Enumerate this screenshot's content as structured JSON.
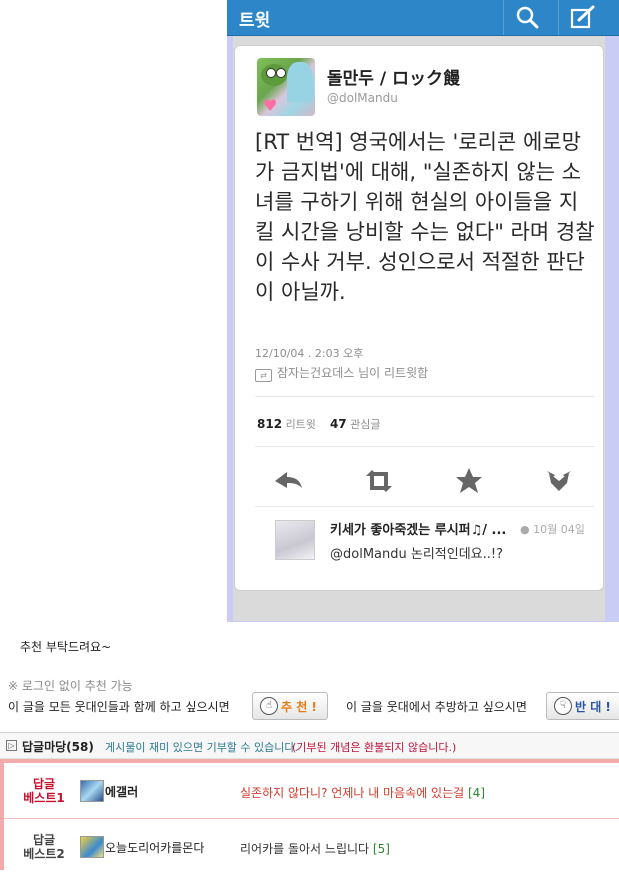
{
  "tweet_app": {
    "header_title": "트윗",
    "author_name": "돌만두 / ロック饅",
    "author_handle": "@dolMandu",
    "tweet_text": "[RT 번역] 영국에서는 '로리콘 에로망가 금지법'에 대해, \"실존하지 않는 소녀를 구하기 위해 현실의 아이들을 지킬 시간을 낭비할 수는 없다\" 라며 경찰이 수사 거부. 성인으로서 적절한 판단이 아닐까.",
    "timestamp": "12/10/04 . 2:03 오후",
    "retweeted_by": "잠자는건요데스 님이 리트윗함",
    "retweet_count": "812",
    "retweet_label": "리트윗",
    "favorite_count": "47",
    "favorite_label": "관심글",
    "reply_name": "키세가 좋아죽겠는 루시퍼♫/ ...",
    "reply_time": "10월 04일",
    "reply_text": "@dolMandu 논리적인데요..!?"
  },
  "post": {
    "request_text": "추천 부탁드려요~",
    "login_note": "※ 로그인 없이 추천 가능",
    "recommend_prompt": "이 글을 모든 웃대인들과 함께 하고 싶으시면",
    "recommend_label": "추 천 !",
    "oppose_prompt": "이 글을 웃대에서 추방하고 싶으시면",
    "oppose_label": "반 대 !"
  },
  "comments": {
    "title": "답글마당",
    "count": "(58)",
    "note1": "게시물이 재미 있으면 기부할 수 있습니다.",
    "note2": "(기부된 개념은 환불되지 않습니다.)",
    "best": [
      {
        "rank_line1": "답글",
        "rank_line2": "베스트1",
        "user": "에갤러",
        "text": "실존하지 않다니? 언제나 내 마음속에 있는걸",
        "count": "[4]"
      },
      {
        "rank_line1": "답글",
        "rank_line2": "베스트2",
        "user": "오늘도리어카를몬다",
        "text": "리어카를 돌아서 느립니다",
        "count": "[5]"
      }
    ]
  },
  "colors": {
    "twitter_header": "#2d86c8",
    "recommend_text": "#e87a12",
    "oppose_text": "#2854a8",
    "best1_rank": "#c8102e",
    "best_border": "#f2aaaa"
  }
}
